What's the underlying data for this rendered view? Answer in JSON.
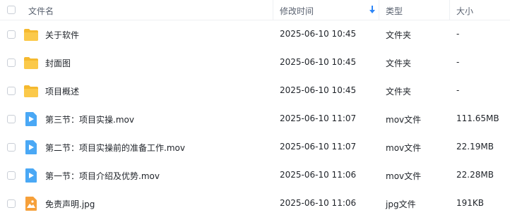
{
  "header": {
    "name_label": "文件名",
    "time_label": "修改时间",
    "type_label": "类型",
    "size_label": "大小",
    "sort_icon": "arrow-down-icon",
    "sort_color": "#2e86f7"
  },
  "colors": {
    "folder": "#f5b92f",
    "video": "#4aa8f5",
    "image": "#f6a03a"
  },
  "files": [
    {
      "name": "关于软件",
      "time": "2025-06-10 10:45",
      "type": "文件夹",
      "size": "-",
      "icon": "folder-icon"
    },
    {
      "name": "封面图",
      "time": "2025-06-10 10:45",
      "type": "文件夹",
      "size": "-",
      "icon": "folder-icon"
    },
    {
      "name": "项目概述",
      "time": "2025-06-10 10:45",
      "type": "文件夹",
      "size": "-",
      "icon": "folder-icon"
    },
    {
      "name": "第三节：项目实操.mov",
      "time": "2025-06-10 11:07",
      "type": "mov文件",
      "size": "111.65MB",
      "icon": "video-file-icon"
    },
    {
      "name": "第二节：项目实操前的准备工作.mov",
      "time": "2025-06-10 11:07",
      "type": "mov文件",
      "size": "22.19MB",
      "icon": "video-file-icon"
    },
    {
      "name": "第一节：项目介绍及优势.mov",
      "time": "2025-06-10 11:06",
      "type": "mov文件",
      "size": "22.28MB",
      "icon": "video-file-icon"
    },
    {
      "name": "免责声明.jpg",
      "time": "2025-06-10 11:06",
      "type": "jpg文件",
      "size": "191KB",
      "icon": "image-file-icon"
    }
  ]
}
